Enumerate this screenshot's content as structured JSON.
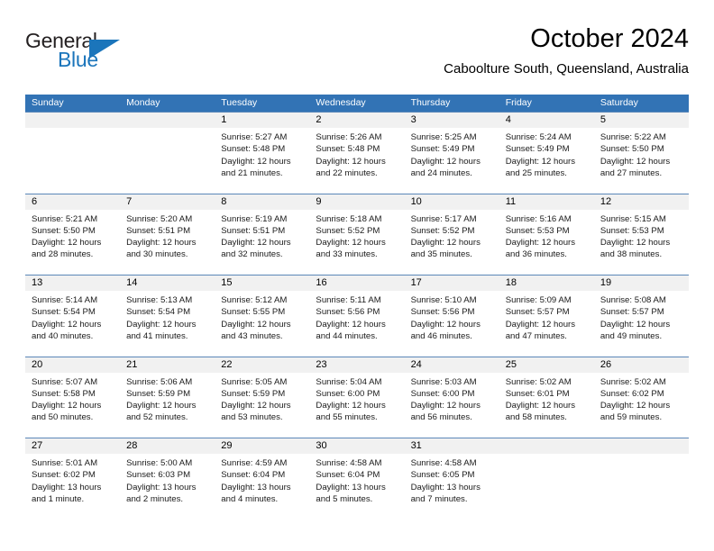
{
  "logo": {
    "word1": "General",
    "word2": "Blue",
    "triangle_color": "#1b75bb",
    "word1_color": "#231f20",
    "word2_color": "#1b75bb"
  },
  "header": {
    "title": "October 2024",
    "subtitle": "Caboolture South, Queensland, Australia"
  },
  "theme": {
    "header_bar_color": "#3273b5",
    "day_band_color": "#f1f1f1",
    "row_divider_color": "#5b87b8"
  },
  "weekdays": [
    "Sunday",
    "Monday",
    "Tuesday",
    "Wednesday",
    "Thursday",
    "Friday",
    "Saturday"
  ],
  "weeks": [
    [
      {
        "day": "",
        "sunrise": "",
        "sunset": "",
        "daylight_line1": "",
        "daylight_line2": ""
      },
      {
        "day": "",
        "sunrise": "",
        "sunset": "",
        "daylight_line1": "",
        "daylight_line2": ""
      },
      {
        "day": "1",
        "sunrise": "Sunrise: 5:27 AM",
        "sunset": "Sunset: 5:48 PM",
        "daylight_line1": "Daylight: 12 hours",
        "daylight_line2": "and 21 minutes."
      },
      {
        "day": "2",
        "sunrise": "Sunrise: 5:26 AM",
        "sunset": "Sunset: 5:48 PM",
        "daylight_line1": "Daylight: 12 hours",
        "daylight_line2": "and 22 minutes."
      },
      {
        "day": "3",
        "sunrise": "Sunrise: 5:25 AM",
        "sunset": "Sunset: 5:49 PM",
        "daylight_line1": "Daylight: 12 hours",
        "daylight_line2": "and 24 minutes."
      },
      {
        "day": "4",
        "sunrise": "Sunrise: 5:24 AM",
        "sunset": "Sunset: 5:49 PM",
        "daylight_line1": "Daylight: 12 hours",
        "daylight_line2": "and 25 minutes."
      },
      {
        "day": "5",
        "sunrise": "Sunrise: 5:22 AM",
        "sunset": "Sunset: 5:50 PM",
        "daylight_line1": "Daylight: 12 hours",
        "daylight_line2": "and 27 minutes."
      }
    ],
    [
      {
        "day": "6",
        "sunrise": "Sunrise: 5:21 AM",
        "sunset": "Sunset: 5:50 PM",
        "daylight_line1": "Daylight: 12 hours",
        "daylight_line2": "and 28 minutes."
      },
      {
        "day": "7",
        "sunrise": "Sunrise: 5:20 AM",
        "sunset": "Sunset: 5:51 PM",
        "daylight_line1": "Daylight: 12 hours",
        "daylight_line2": "and 30 minutes."
      },
      {
        "day": "8",
        "sunrise": "Sunrise: 5:19 AM",
        "sunset": "Sunset: 5:51 PM",
        "daylight_line1": "Daylight: 12 hours",
        "daylight_line2": "and 32 minutes."
      },
      {
        "day": "9",
        "sunrise": "Sunrise: 5:18 AM",
        "sunset": "Sunset: 5:52 PM",
        "daylight_line1": "Daylight: 12 hours",
        "daylight_line2": "and 33 minutes."
      },
      {
        "day": "10",
        "sunrise": "Sunrise: 5:17 AM",
        "sunset": "Sunset: 5:52 PM",
        "daylight_line1": "Daylight: 12 hours",
        "daylight_line2": "and 35 minutes."
      },
      {
        "day": "11",
        "sunrise": "Sunrise: 5:16 AM",
        "sunset": "Sunset: 5:53 PM",
        "daylight_line1": "Daylight: 12 hours",
        "daylight_line2": "and 36 minutes."
      },
      {
        "day": "12",
        "sunrise": "Sunrise: 5:15 AM",
        "sunset": "Sunset: 5:53 PM",
        "daylight_line1": "Daylight: 12 hours",
        "daylight_line2": "and 38 minutes."
      }
    ],
    [
      {
        "day": "13",
        "sunrise": "Sunrise: 5:14 AM",
        "sunset": "Sunset: 5:54 PM",
        "daylight_line1": "Daylight: 12 hours",
        "daylight_line2": "and 40 minutes."
      },
      {
        "day": "14",
        "sunrise": "Sunrise: 5:13 AM",
        "sunset": "Sunset: 5:54 PM",
        "daylight_line1": "Daylight: 12 hours",
        "daylight_line2": "and 41 minutes."
      },
      {
        "day": "15",
        "sunrise": "Sunrise: 5:12 AM",
        "sunset": "Sunset: 5:55 PM",
        "daylight_line1": "Daylight: 12 hours",
        "daylight_line2": "and 43 minutes."
      },
      {
        "day": "16",
        "sunrise": "Sunrise: 5:11 AM",
        "sunset": "Sunset: 5:56 PM",
        "daylight_line1": "Daylight: 12 hours",
        "daylight_line2": "and 44 minutes."
      },
      {
        "day": "17",
        "sunrise": "Sunrise: 5:10 AM",
        "sunset": "Sunset: 5:56 PM",
        "daylight_line1": "Daylight: 12 hours",
        "daylight_line2": "and 46 minutes."
      },
      {
        "day": "18",
        "sunrise": "Sunrise: 5:09 AM",
        "sunset": "Sunset: 5:57 PM",
        "daylight_line1": "Daylight: 12 hours",
        "daylight_line2": "and 47 minutes."
      },
      {
        "day": "19",
        "sunrise": "Sunrise: 5:08 AM",
        "sunset": "Sunset: 5:57 PM",
        "daylight_line1": "Daylight: 12 hours",
        "daylight_line2": "and 49 minutes."
      }
    ],
    [
      {
        "day": "20",
        "sunrise": "Sunrise: 5:07 AM",
        "sunset": "Sunset: 5:58 PM",
        "daylight_line1": "Daylight: 12 hours",
        "daylight_line2": "and 50 minutes."
      },
      {
        "day": "21",
        "sunrise": "Sunrise: 5:06 AM",
        "sunset": "Sunset: 5:59 PM",
        "daylight_line1": "Daylight: 12 hours",
        "daylight_line2": "and 52 minutes."
      },
      {
        "day": "22",
        "sunrise": "Sunrise: 5:05 AM",
        "sunset": "Sunset: 5:59 PM",
        "daylight_line1": "Daylight: 12 hours",
        "daylight_line2": "and 53 minutes."
      },
      {
        "day": "23",
        "sunrise": "Sunrise: 5:04 AM",
        "sunset": "Sunset: 6:00 PM",
        "daylight_line1": "Daylight: 12 hours",
        "daylight_line2": "and 55 minutes."
      },
      {
        "day": "24",
        "sunrise": "Sunrise: 5:03 AM",
        "sunset": "Sunset: 6:00 PM",
        "daylight_line1": "Daylight: 12 hours",
        "daylight_line2": "and 56 minutes."
      },
      {
        "day": "25",
        "sunrise": "Sunrise: 5:02 AM",
        "sunset": "Sunset: 6:01 PM",
        "daylight_line1": "Daylight: 12 hours",
        "daylight_line2": "and 58 minutes."
      },
      {
        "day": "26",
        "sunrise": "Sunrise: 5:02 AM",
        "sunset": "Sunset: 6:02 PM",
        "daylight_line1": "Daylight: 12 hours",
        "daylight_line2": "and 59 minutes."
      }
    ],
    [
      {
        "day": "27",
        "sunrise": "Sunrise: 5:01 AM",
        "sunset": "Sunset: 6:02 PM",
        "daylight_line1": "Daylight: 13 hours",
        "daylight_line2": "and 1 minute."
      },
      {
        "day": "28",
        "sunrise": "Sunrise: 5:00 AM",
        "sunset": "Sunset: 6:03 PM",
        "daylight_line1": "Daylight: 13 hours",
        "daylight_line2": "and 2 minutes."
      },
      {
        "day": "29",
        "sunrise": "Sunrise: 4:59 AM",
        "sunset": "Sunset: 6:04 PM",
        "daylight_line1": "Daylight: 13 hours",
        "daylight_line2": "and 4 minutes."
      },
      {
        "day": "30",
        "sunrise": "Sunrise: 4:58 AM",
        "sunset": "Sunset: 6:04 PM",
        "daylight_line1": "Daylight: 13 hours",
        "daylight_line2": "and 5 minutes."
      },
      {
        "day": "31",
        "sunrise": "Sunrise: 4:58 AM",
        "sunset": "Sunset: 6:05 PM",
        "daylight_line1": "Daylight: 13 hours",
        "daylight_line2": "and 7 minutes."
      },
      {
        "day": "",
        "sunrise": "",
        "sunset": "",
        "daylight_line1": "",
        "daylight_line2": ""
      },
      {
        "day": "",
        "sunrise": "",
        "sunset": "",
        "daylight_line1": "",
        "daylight_line2": ""
      }
    ]
  ]
}
